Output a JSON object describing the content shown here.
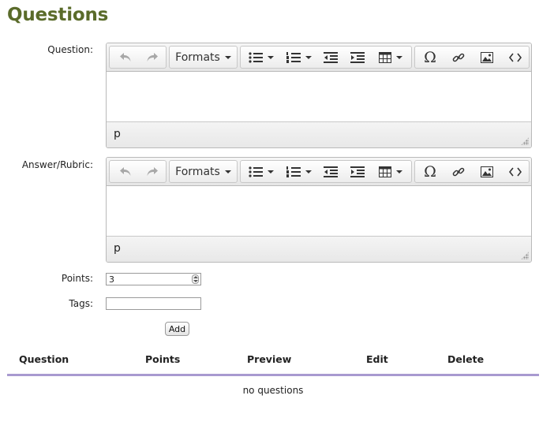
{
  "page": {
    "title": "Questions"
  },
  "form": {
    "question_label": "Question:",
    "answer_label": "Answer/Rubric:",
    "points_label": "Points:",
    "points_value": "3",
    "tags_label": "Tags:",
    "tags_value": "",
    "add_label": "Add"
  },
  "editor": {
    "formats_label": "Formats",
    "status_path": "p",
    "toolbar_icons": [
      "undo-icon",
      "redo-icon",
      "formats-dropdown",
      "bullet-list-icon",
      "numbered-list-icon",
      "outdent-icon",
      "indent-icon",
      "table-icon",
      "special-character-icon",
      "link-icon",
      "image-icon",
      "source-code-icon"
    ]
  },
  "table": {
    "headers": [
      "Question",
      "Points",
      "Preview",
      "Edit",
      "Delete"
    ],
    "empty_message": "no questions",
    "rule_color": "#a89ad0"
  },
  "colors": {
    "title": "#5a6b2a"
  }
}
